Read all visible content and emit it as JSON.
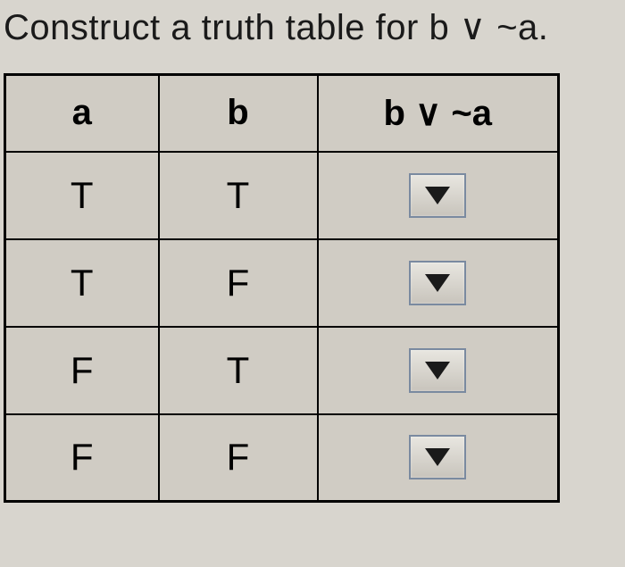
{
  "prompt": "Construct a truth table for b ∨ ~a.",
  "headers": {
    "col_a": "a",
    "col_b": "b",
    "col_result": "b ∨ ~a"
  },
  "rows": [
    {
      "a": "T",
      "b": "T",
      "result": ""
    },
    {
      "a": "T",
      "b": "F",
      "result": ""
    },
    {
      "a": "F",
      "b": "T",
      "result": ""
    },
    {
      "a": "F",
      "b": "F",
      "result": ""
    }
  ],
  "icons": {
    "dropdown": "▼"
  }
}
